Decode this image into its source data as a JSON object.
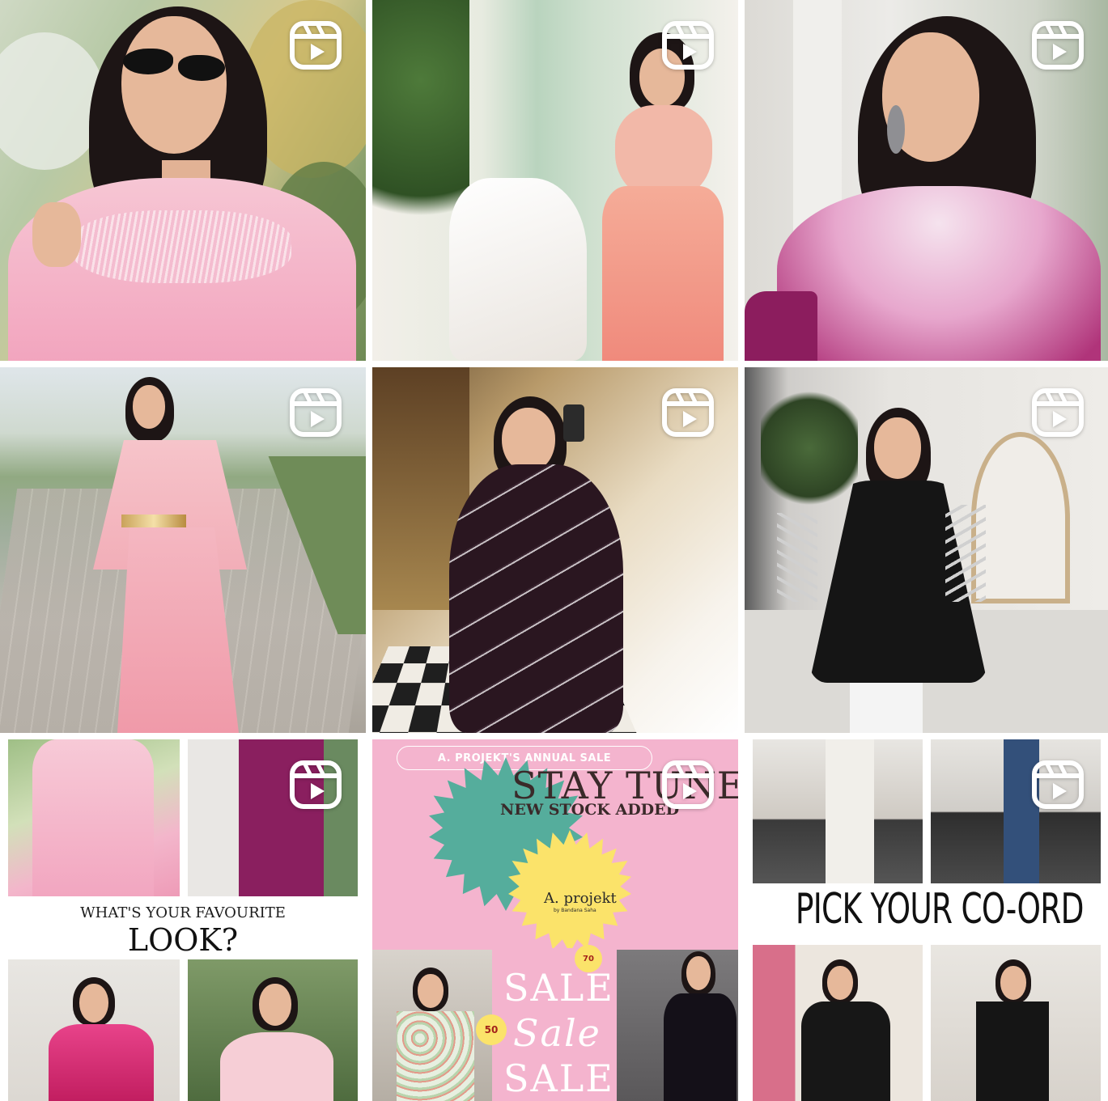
{
  "grid": {
    "tiles": [
      {
        "id": 1,
        "type": "reel",
        "icon": "reels-icon"
      },
      {
        "id": 2,
        "type": "reel",
        "icon": "reels-icon"
      },
      {
        "id": 3,
        "type": "reel",
        "icon": "reels-icon"
      },
      {
        "id": 4,
        "type": "reel",
        "icon": "reels-icon"
      },
      {
        "id": 5,
        "type": "reel",
        "icon": "reels-icon"
      },
      {
        "id": 6,
        "type": "reel",
        "icon": "reels-icon"
      },
      {
        "id": 7,
        "type": "reel",
        "icon": "reels-icon"
      },
      {
        "id": 8,
        "type": "reel",
        "icon": "reels-icon"
      },
      {
        "id": 9,
        "type": "reel",
        "icon": "reels-icon"
      }
    ]
  },
  "tile7": {
    "question_line1": "WHAT'S YOUR FAVOURITE",
    "question_line2": "LOOK?"
  },
  "tile8": {
    "banner": "A. PROJEKT'S ANNUAL SALE",
    "headline": "STAY TUNED",
    "subheadline": "NEW STOCK ADDED",
    "logo": "A. projekt",
    "logo_tag": "by Bandana Saha",
    "sale_words": [
      "SALE",
      "Sale",
      "SALE"
    ],
    "discount_a": "70",
    "discount_b": "50"
  },
  "tile9": {
    "headline": "PICK YOUR CO-ORD"
  },
  "colors": {
    "tile8_background": "#f4b4ce",
    "teal_burst": "#55ad9c",
    "yellow_burst": "#fbe36a",
    "icon_white": "#ffffff"
  }
}
